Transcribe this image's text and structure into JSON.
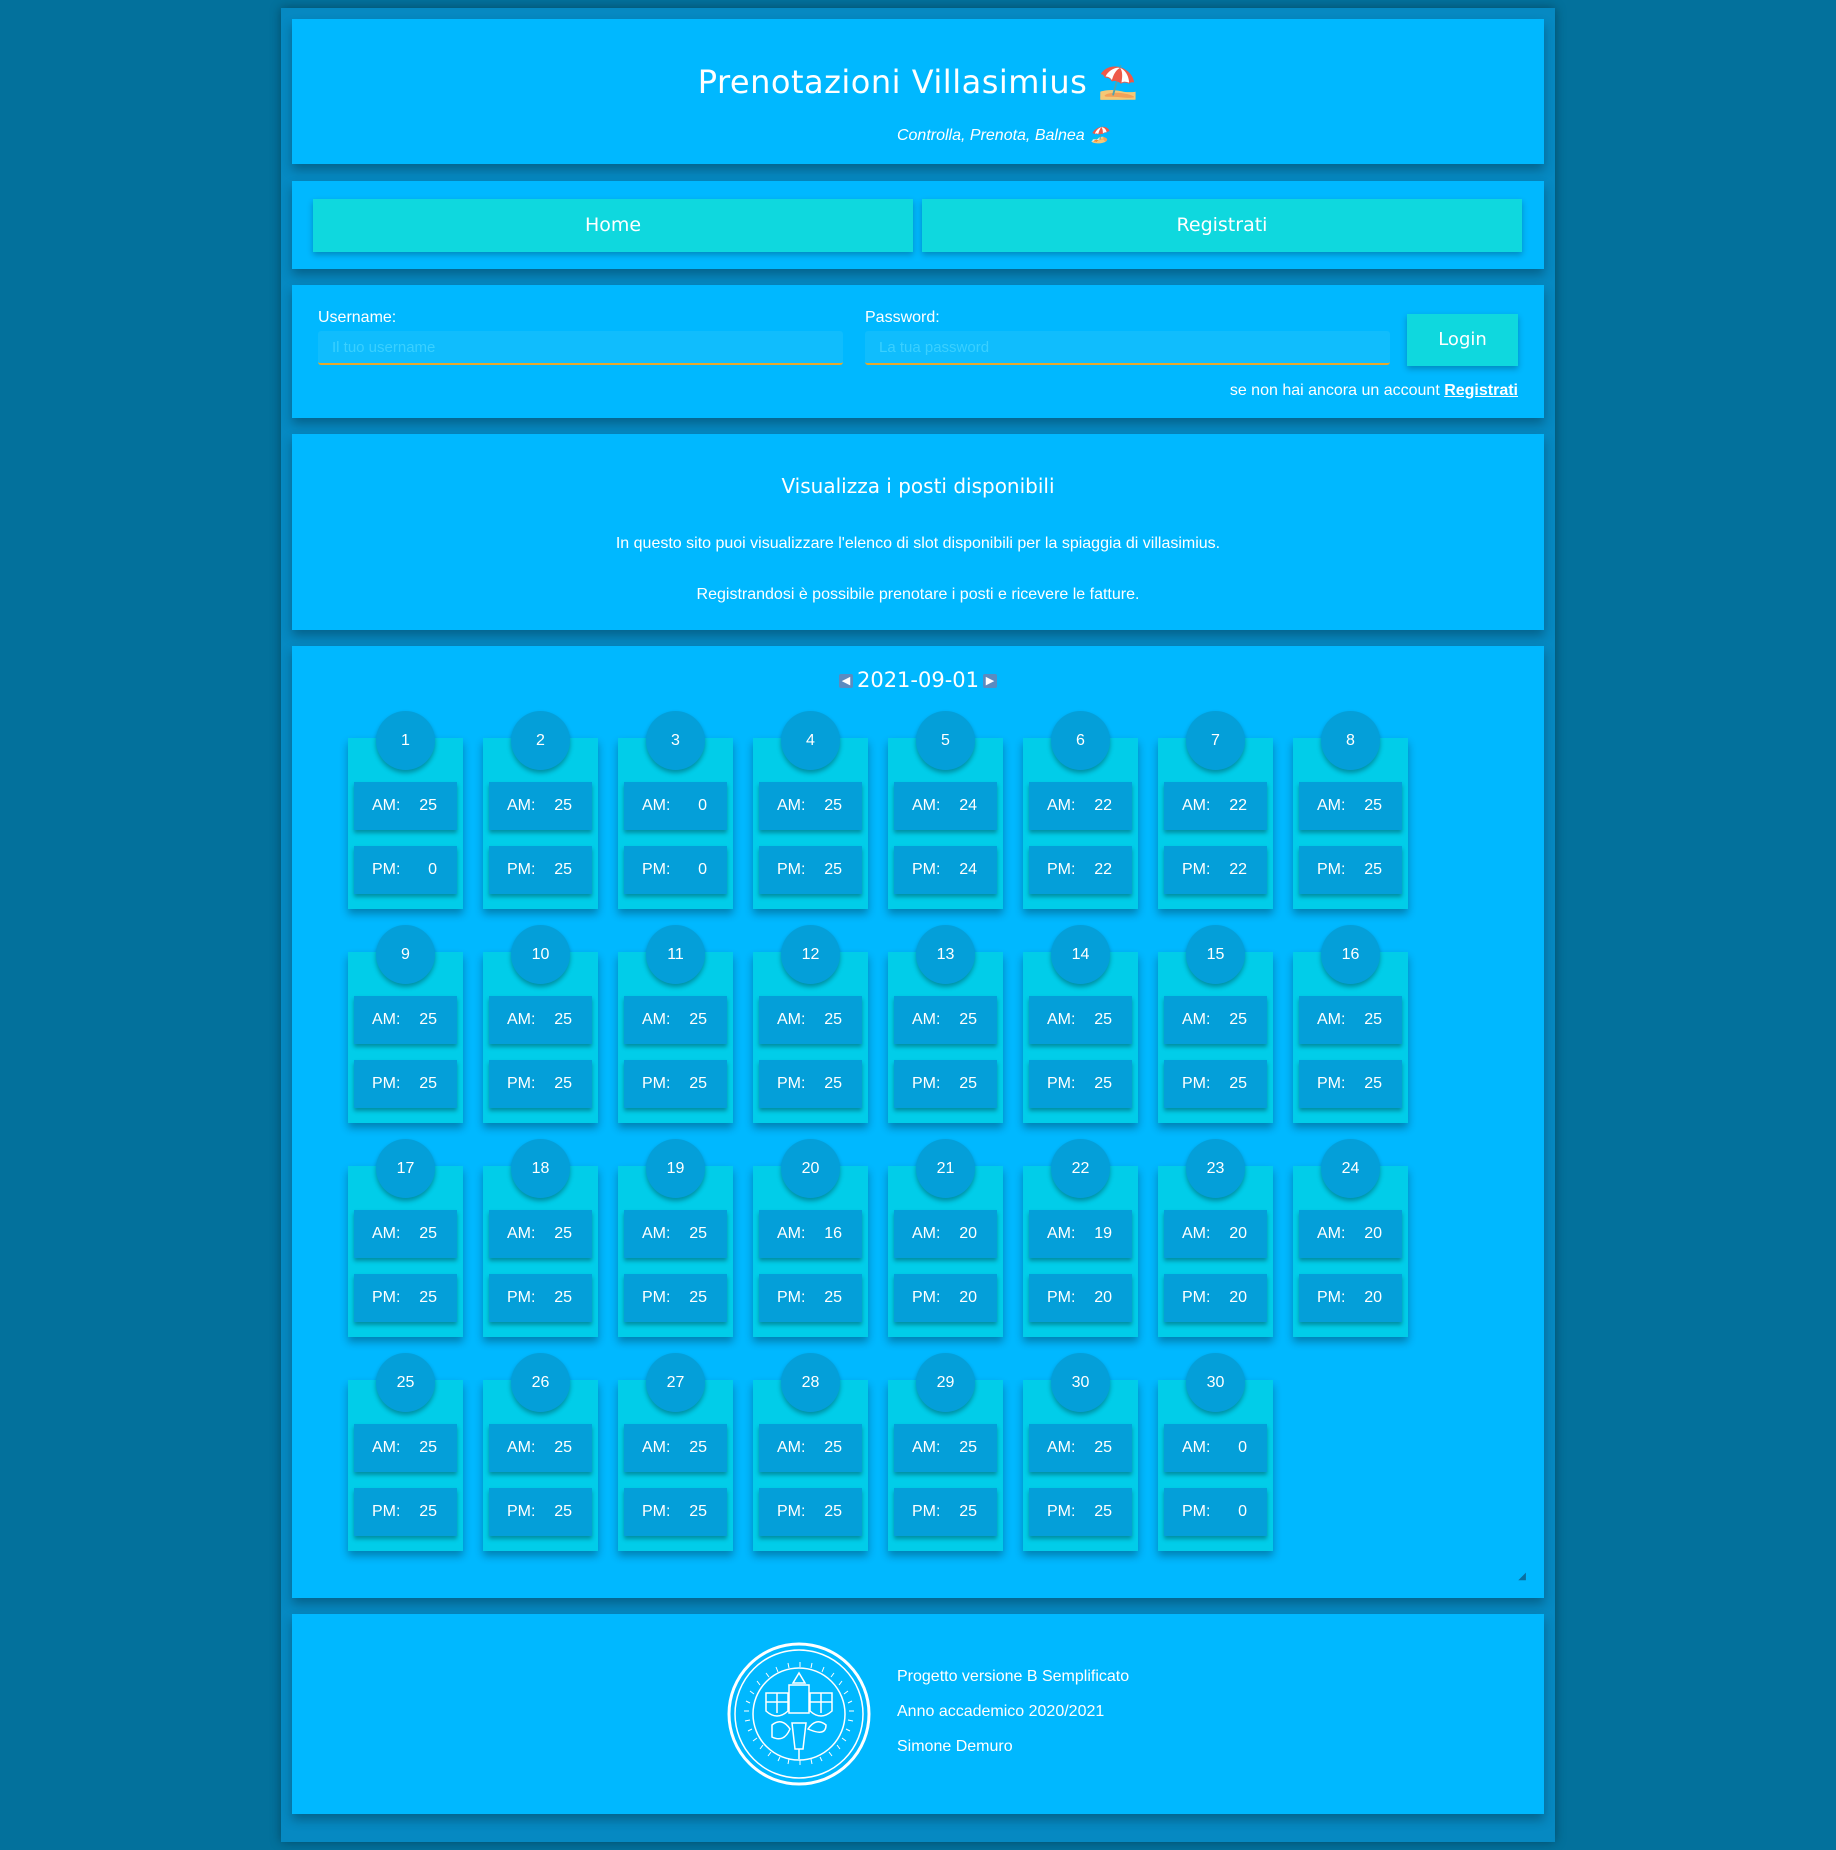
{
  "header": {
    "title": "Prenotazioni Villasimius ⛱️",
    "subtitle": "Controlla, Prenota, Balnea 🏖️"
  },
  "nav": {
    "home": "Home",
    "register": "Registrati"
  },
  "login": {
    "username_label": "Username:",
    "username_placeholder": "Il tuo username",
    "password_label": "Password:",
    "password_placeholder": "La tua password",
    "button": "Login",
    "hint_text": "se non hai ancora un account ",
    "hint_link": "Registrati"
  },
  "info": {
    "heading": "Visualizza i posti disponibili",
    "paragraph1": "In questo sito puoi visualizzare l'elenco di slot disponibili per la spiaggia di villasimius.",
    "paragraph2": "Registrandosi è possibile prenotare i posti e ricevere le fatture."
  },
  "calendar": {
    "date": "2021-09-01",
    "prev_icon": "arrow-left-icon",
    "next_icon": "arrow-right-icon",
    "am_label": "AM:",
    "pm_label": "PM:",
    "days": [
      {
        "day": "1",
        "am": "25",
        "pm": "0"
      },
      {
        "day": "2",
        "am": "25",
        "pm": "25"
      },
      {
        "day": "3",
        "am": "0",
        "pm": "0"
      },
      {
        "day": "4",
        "am": "25",
        "pm": "25"
      },
      {
        "day": "5",
        "am": "24",
        "pm": "24"
      },
      {
        "day": "6",
        "am": "22",
        "pm": "22"
      },
      {
        "day": "7",
        "am": "22",
        "pm": "22"
      },
      {
        "day": "8",
        "am": "25",
        "pm": "25"
      },
      {
        "day": "9",
        "am": "25",
        "pm": "25"
      },
      {
        "day": "10",
        "am": "25",
        "pm": "25"
      },
      {
        "day": "11",
        "am": "25",
        "pm": "25"
      },
      {
        "day": "12",
        "am": "25",
        "pm": "25"
      },
      {
        "day": "13",
        "am": "25",
        "pm": "25"
      },
      {
        "day": "14",
        "am": "25",
        "pm": "25"
      },
      {
        "day": "15",
        "am": "25",
        "pm": "25"
      },
      {
        "day": "16",
        "am": "25",
        "pm": "25"
      },
      {
        "day": "17",
        "am": "25",
        "pm": "25"
      },
      {
        "day": "18",
        "am": "25",
        "pm": "25"
      },
      {
        "day": "19",
        "am": "25",
        "pm": "25"
      },
      {
        "day": "20",
        "am": "16",
        "pm": "25"
      },
      {
        "day": "21",
        "am": "20",
        "pm": "20"
      },
      {
        "day": "22",
        "am": "19",
        "pm": "20"
      },
      {
        "day": "23",
        "am": "20",
        "pm": "20"
      },
      {
        "day": "24",
        "am": "20",
        "pm": "20"
      },
      {
        "day": "25",
        "am": "25",
        "pm": "25"
      },
      {
        "day": "26",
        "am": "25",
        "pm": "25"
      },
      {
        "day": "27",
        "am": "25",
        "pm": "25"
      },
      {
        "day": "28",
        "am": "25",
        "pm": "25"
      },
      {
        "day": "29",
        "am": "25",
        "pm": "25"
      },
      {
        "day": "30",
        "am": "25",
        "pm": "25"
      },
      {
        "day": "30",
        "am": "0",
        "pm": "0"
      }
    ]
  },
  "footer": {
    "seal_icon": "university-seal-icon",
    "line1": "Progetto versione B Semplificato",
    "line2": "Anno accademico 2020/2021",
    "line3": "Simone Demuro"
  }
}
